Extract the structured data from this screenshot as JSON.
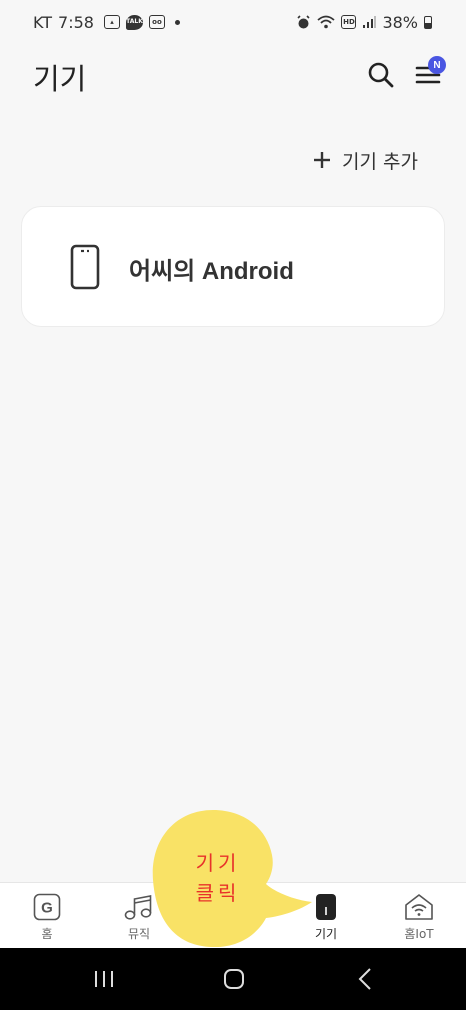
{
  "status_bar": {
    "carrier": "KT",
    "time": "7:58",
    "battery": "38%",
    "icons": [
      "image-icon",
      "talk-icon",
      "voicemail-icon",
      "alarm-icon",
      "wifi-icon",
      "hd-icon",
      "signal-icon",
      "battery-icon"
    ]
  },
  "header": {
    "title": "기기",
    "badge": "N"
  },
  "add_device": {
    "label": "기기 추가"
  },
  "devices": [
    {
      "name": "어씨의 Android",
      "icon": "smartphone-icon"
    }
  ],
  "bottom_nav": {
    "items": [
      {
        "label": "홈",
        "icon": "g-home-icon"
      },
      {
        "label": "뮤직",
        "icon": "music-note-icon"
      },
      {
        "label": "기기",
        "icon": "device-icon"
      },
      {
        "label": "홈IoT",
        "icon": "home-iot-icon"
      }
    ],
    "active_index": 2
  },
  "annotation": {
    "text": "기기 클릭"
  },
  "colors": {
    "background": "#f7f7f7",
    "badge": "#4a56e2",
    "bubble": "#f9e266",
    "annotation_text": "#e8322a"
  }
}
